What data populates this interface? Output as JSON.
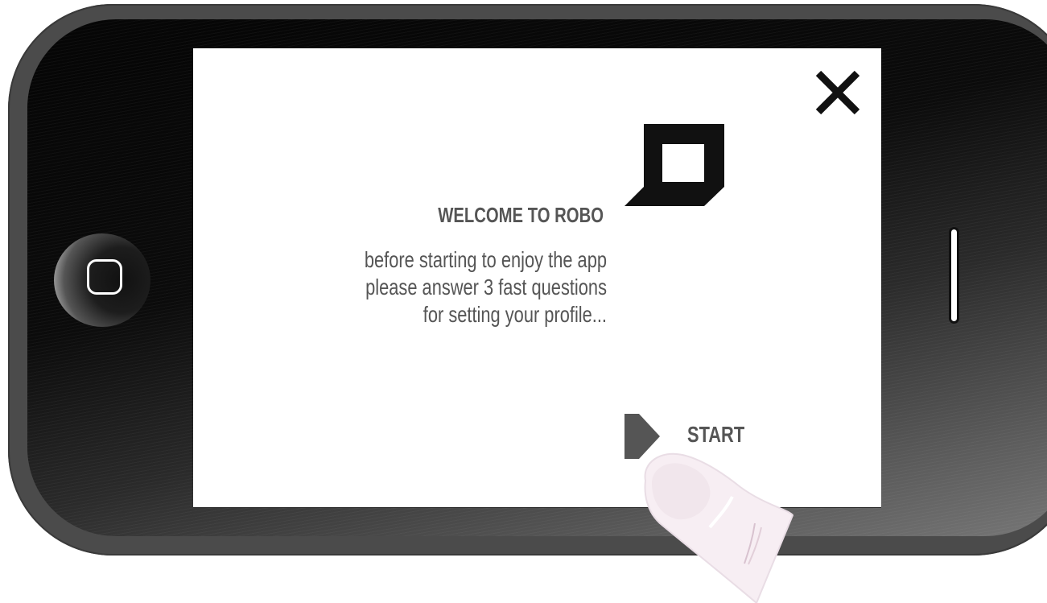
{
  "dialog": {
    "title": "WELCOME TO ROBO",
    "body_lines": [
      "before starting to enjoy the app",
      "please answer 3 fast questions",
      "for setting your profile..."
    ],
    "start_label": "START"
  },
  "icons": {
    "close": "close-icon",
    "logo": "robo-logo",
    "start": "play-arrow-icon",
    "home": "home-button-icon"
  },
  "colors": {
    "text": "#555555",
    "logo": "#111111",
    "frame": "#4b4b4b",
    "screen": "#ffffff"
  }
}
